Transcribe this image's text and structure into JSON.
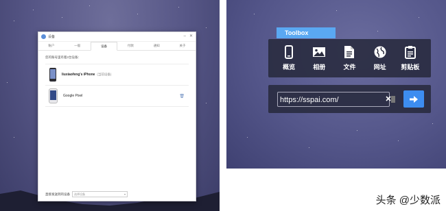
{
  "left": {
    "window": {
      "title": "设备",
      "min_icon": "minimize-icon",
      "close_icon": "close-icon",
      "tabs": [
        {
          "label": "账户"
        },
        {
          "label": "一般"
        },
        {
          "label": "设备",
          "active": true
        },
        {
          "label": "付款"
        },
        {
          "label": "通知"
        },
        {
          "label": "关于"
        }
      ],
      "info_text": "您的账号里有着2台设备：",
      "devices": [
        {
          "name": "liuxiaofeng's iPhone",
          "tag": "(当前设备)",
          "icon": "iphone-icon"
        },
        {
          "name": "Google Pixel",
          "tag": "",
          "icon": "android-phone-icon",
          "action_icon": "trash-icon"
        }
      ],
      "bottom_label": "直接发送到的设备",
      "select_value": "选择设备"
    }
  },
  "right": {
    "toolbox_title": "Toolbox",
    "tools": [
      {
        "label": "概览",
        "icon": "phone-icon"
      },
      {
        "label": "相册",
        "icon": "image-icon"
      },
      {
        "label": "文件",
        "icon": "file-icon"
      },
      {
        "label": "网址",
        "icon": "globe-icon"
      },
      {
        "label": "剪贴板",
        "icon": "clipboard-icon"
      }
    ],
    "url_value": "https://sspai.com/",
    "go_icon": "arrow-right-icon"
  },
  "watermark": "头条 @少数派",
  "colors": {
    "accent": "#3d8df0",
    "toolbox_tag": "#5aa8f2",
    "panel_bg": "#2a2c3e"
  }
}
